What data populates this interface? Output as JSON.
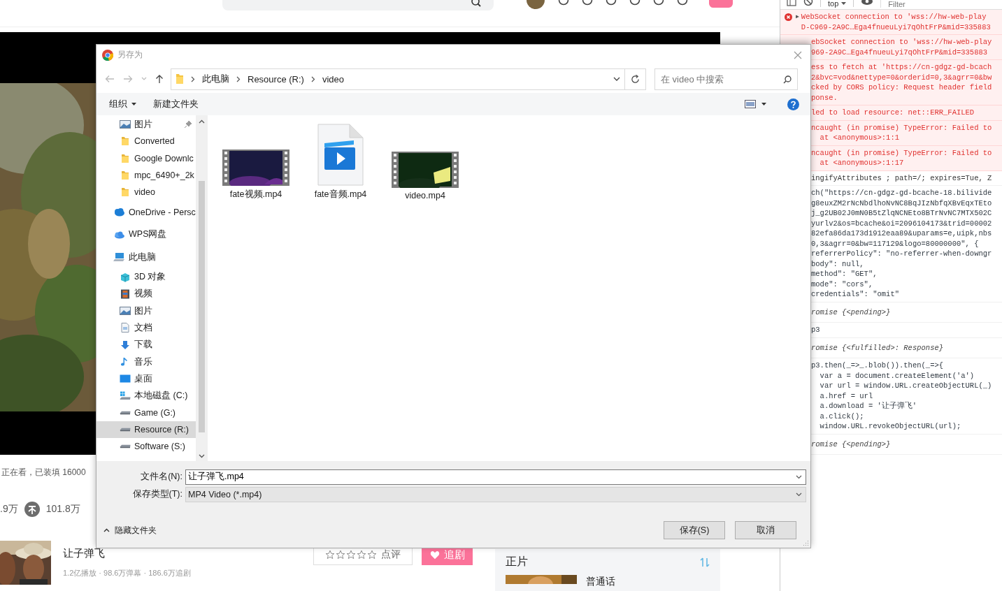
{
  "page": {
    "watching": "正在看，已装填 16000",
    "likes": ".9万",
    "coins": "101.8万",
    "show": {
      "title": "让子弹飞",
      "stats": "1.2亿播放 · 98.6万弹幕 · 186.6万追剧",
      "stars": 0,
      "review": "点评",
      "follow": "追剧"
    },
    "episodes": {
      "title": "正片",
      "first": "普通话"
    }
  },
  "dialog": {
    "title": "另存为",
    "path": [
      "此电脑",
      "Resource (R:)",
      "video"
    ],
    "search": {
      "placeholder": "在 video 中搜索"
    },
    "organize": "组织",
    "new_folder": "新建文件夹",
    "quick_access": [
      {
        "kind": "pictures",
        "label": "图片",
        "pinned": true,
        "selected": false
      },
      {
        "kind": "folder",
        "label": "Converted",
        "pinned": false,
        "selected": false
      },
      {
        "kind": "folder",
        "label": "Google Downlc",
        "pinned": false,
        "selected": false
      },
      {
        "kind": "folder",
        "label": "mpc_6490+_2k",
        "pinned": false,
        "selected": false
      },
      {
        "kind": "folder",
        "label": "video",
        "pinned": false,
        "selected": false
      }
    ],
    "nav_tree": [
      {
        "kind": "cloud",
        "label": "OneDrive - Persc",
        "selected": false
      },
      {
        "kind": "wps",
        "label": "WPS网盘",
        "selected": false
      },
      {
        "kind": "pc",
        "label": "此电脑",
        "selected": false,
        "children": [
          {
            "kind": "cube",
            "label": "3D 对象",
            "selected": false
          },
          {
            "kind": "video",
            "label": "视频",
            "selected": false
          },
          {
            "kind": "pictures",
            "label": "图片",
            "selected": false
          },
          {
            "kind": "document",
            "label": "文档",
            "selected": false
          },
          {
            "kind": "download",
            "label": "下载",
            "selected": false
          },
          {
            "kind": "music",
            "label": "音乐",
            "selected": false
          },
          {
            "kind": "desktop",
            "label": "桌面",
            "selected": false
          },
          {
            "kind": "system-drive",
            "label": "本地磁盘 (C:)",
            "selected": false
          },
          {
            "kind": "drive",
            "label": "Game (G:)",
            "selected": false
          },
          {
            "kind": "drive",
            "label": "Resource (R:)",
            "selected": true
          },
          {
            "kind": "drive",
            "label": "Software (S:)",
            "selected": false
          }
        ]
      }
    ],
    "files": [
      {
        "kind": "video",
        "name": "fate视频.mp4",
        "selected": false
      },
      {
        "kind": "media",
        "name": "fate音频.mp4",
        "selected": false
      },
      {
        "kind": "video",
        "name": "video.mp4",
        "selected": false
      }
    ],
    "filename_label": "文件名(N):",
    "filename": "让子弹飞.mp4",
    "filetype_label": "保存类型(T):",
    "filetype": "MP4 Video (*.mp4)",
    "hide_folders": "隐藏文件夹",
    "save": "保存(S)",
    "cancel": "取消"
  },
  "devtools": {
    "context": "top",
    "filter": {
      "placeholder": "Filter"
    },
    "messages": [
      {
        "kind": "error",
        "covered": false,
        "toggle": "▶",
        "lines": [
          "WebSocket connection to 'wss://hw-web-play",
          "D-C969-2A9C…Ega4fnueuLyi7qOhtFrP&mid=335883"
        ]
      },
      {
        "kind": "error",
        "covered": true,
        "lines": [
          "ebSocket connection to 'wss://hw-web-play",
          "969-2A9C…Ega4fnueuLyi7qOhtFrP&mid=335883"
        ]
      },
      {
        "kind": "error",
        "covered": true,
        "lines": [
          "ess to fetch at 'https://cn-gdgz-gd-bcach",
          "2&bvc=vod&nettype=0&orderid=0,3&agrr=0&bw",
          "cked by CORS policy: Request header field",
          "ponse."
        ]
      },
      {
        "kind": "error",
        "covered": true,
        "lines": [
          "led to load resource: net::ERR_FAILED"
        ]
      },
      {
        "kind": "error",
        "covered": true,
        "lines": [
          "ncaught (in promise) TypeError: Failed to",
          "  at <anonymous>:1:1"
        ]
      },
      {
        "kind": "error",
        "covered": true,
        "lines": [
          "ncaught (in promise) TypeError: Failed to",
          "  at <anonymous>:1:17"
        ]
      },
      {
        "kind": "log",
        "covered": true,
        "lines": [
          "ingifyAttributes ; path=/; expires=Tue, Z"
        ]
      },
      {
        "kind": "input",
        "covered": true,
        "lines": [
          "ch(\"https://cn-gdgz-gd-bcache-18.bilivide",
          "g8euxZM2rNcNbdlhoNvNC8BqJIzNbfqXBvEqxTEto",
          "j_g2UB02J0mN0B5tZlqNCNEto8BTrNvNC7MTX502C",
          "yurlv2&os=bcache&oi=2096104173&trid=00002",
          "82efa86da173d1912eaa89&uparams=e,uipk,nbs",
          "0,3&agrr=0&bw=117129&logo=80000000\", {",
          "referrerPolicy\": \"no-referrer-when-downgr",
          "body\": null,",
          "method\": \"GET\",",
          "mode\": \"cors\",",
          "credentials\": \"omit\""
        ]
      },
      {
        "kind": "result",
        "covered": true,
        "lines": [
          "romise {<pending>}"
        ]
      },
      {
        "kind": "input",
        "covered": true,
        "lines": [
          "p3"
        ]
      },
      {
        "kind": "result",
        "covered": true,
        "lines": [
          "romise {<fulfilled>: Response}"
        ]
      },
      {
        "kind": "input",
        "covered": true,
        "lines": [
          "p3.then(_=>_.blob()).then(_=>{",
          "  var a = document.createElement('a')",
          "  var url = window.URL.createObjectURL(_)",
          "  a.href = url",
          "  a.download = '让子弹飞'",
          "  a.click();",
          "  window.URL.revokeObjectURL(url);"
        ]
      },
      {
        "kind": "result",
        "covered": true,
        "lines": [
          "romise {<pending>}"
        ]
      }
    ]
  }
}
